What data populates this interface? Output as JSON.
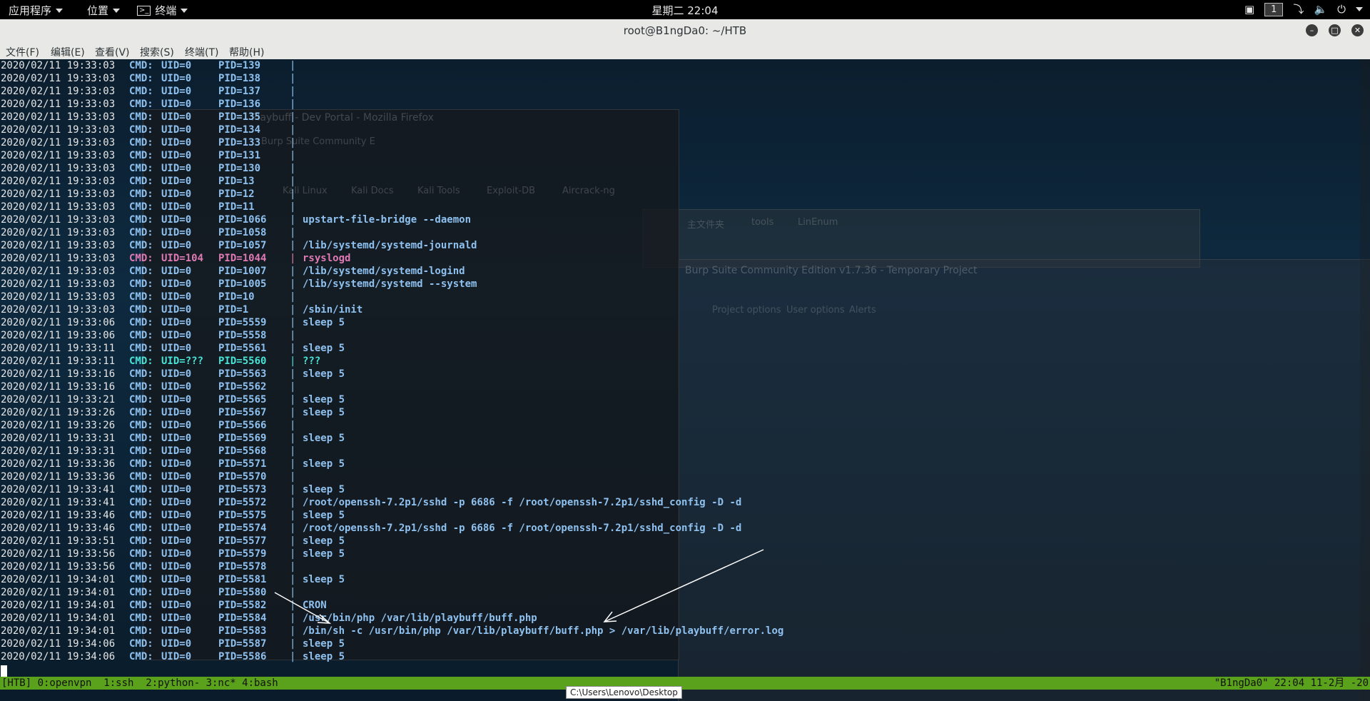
{
  "topbar": {
    "apps": "应用程序",
    "places": "位置",
    "terminal": "终端",
    "clock": "星期二 22:04",
    "workspace": "1"
  },
  "window": {
    "title": "root@B1ngDa0: ~/HTB"
  },
  "menubar": [
    "文件(F)",
    "编辑(E)",
    "查看(V)",
    "搜索(S)",
    "终端(T)",
    "帮助(H)"
  ],
  "background": {
    "firefox_title": "Playbuff - Dev Portal - Mozilla Firefox",
    "firefox_tab": "Burp Suite Community E",
    "bookmarks": [
      "Kali Linux",
      "Kali Docs",
      "Kali Tools",
      "Exploit-DB",
      "Aircrack-ng"
    ],
    "files_items": [
      "主文件夹",
      "tools",
      "LinEnum"
    ],
    "burp_title": "Burp Suite Community Edition v1.7.36 - Temporary Project",
    "burp_tabs": [
      "Project options",
      "User options",
      "Alerts"
    ]
  },
  "lines": [
    {
      "t": "2020/02/11 19:33:03",
      "cmd": "CMD:",
      "uid": "UID=0",
      "pid": "PID=139",
      "c": ""
    },
    {
      "t": "2020/02/11 19:33:03",
      "cmd": "CMD:",
      "uid": "UID=0",
      "pid": "PID=138",
      "c": ""
    },
    {
      "t": "2020/02/11 19:33:03",
      "cmd": "CMD:",
      "uid": "UID=0",
      "pid": "PID=137",
      "c": ""
    },
    {
      "t": "2020/02/11 19:33:03",
      "cmd": "CMD:",
      "uid": "UID=0",
      "pid": "PID=136",
      "c": ""
    },
    {
      "t": "2020/02/11 19:33:03",
      "cmd": "CMD:",
      "uid": "UID=0",
      "pid": "PID=135",
      "c": ""
    },
    {
      "t": "2020/02/11 19:33:03",
      "cmd": "CMD:",
      "uid": "UID=0",
      "pid": "PID=134",
      "c": ""
    },
    {
      "t": "2020/02/11 19:33:03",
      "cmd": "CMD:",
      "uid": "UID=0",
      "pid": "PID=133",
      "c": ""
    },
    {
      "t": "2020/02/11 19:33:03",
      "cmd": "CMD:",
      "uid": "UID=0",
      "pid": "PID=131",
      "c": ""
    },
    {
      "t": "2020/02/11 19:33:03",
      "cmd": "CMD:",
      "uid": "UID=0",
      "pid": "PID=130",
      "c": ""
    },
    {
      "t": "2020/02/11 19:33:03",
      "cmd": "CMD:",
      "uid": "UID=0",
      "pid": "PID=13",
      "c": ""
    },
    {
      "t": "2020/02/11 19:33:03",
      "cmd": "CMD:",
      "uid": "UID=0",
      "pid": "PID=12",
      "c": ""
    },
    {
      "t": "2020/02/11 19:33:03",
      "cmd": "CMD:",
      "uid": "UID=0",
      "pid": "PID=11",
      "c": ""
    },
    {
      "t": "2020/02/11 19:33:03",
      "cmd": "CMD:",
      "uid": "UID=0",
      "pid": "PID=1066",
      "c": "upstart-file-bridge --daemon"
    },
    {
      "t": "2020/02/11 19:33:03",
      "cmd": "CMD:",
      "uid": "UID=0",
      "pid": "PID=1058",
      "c": ""
    },
    {
      "t": "2020/02/11 19:33:03",
      "cmd": "CMD:",
      "uid": "UID=0",
      "pid": "PID=1057",
      "c": "/lib/systemd/systemd-journald"
    },
    {
      "t": "2020/02/11 19:33:03",
      "cmd": "CMD:",
      "uid": "UID=104",
      "pid": "PID=1044",
      "c": "rsyslogd",
      "style": "red"
    },
    {
      "t": "2020/02/11 19:33:03",
      "cmd": "CMD:",
      "uid": "UID=0",
      "pid": "PID=1007",
      "c": "/lib/systemd/systemd-logind"
    },
    {
      "t": "2020/02/11 19:33:03",
      "cmd": "CMD:",
      "uid": "UID=0",
      "pid": "PID=1005",
      "c": "/lib/systemd/systemd --system"
    },
    {
      "t": "2020/02/11 19:33:03",
      "cmd": "CMD:",
      "uid": "UID=0",
      "pid": "PID=10",
      "c": ""
    },
    {
      "t": "2020/02/11 19:33:03",
      "cmd": "CMD:",
      "uid": "UID=0",
      "pid": "PID=1",
      "c": "/sbin/init"
    },
    {
      "t": "2020/02/11 19:33:06",
      "cmd": "CMD:",
      "uid": "UID=0",
      "pid": "PID=5559",
      "c": "sleep 5"
    },
    {
      "t": "2020/02/11 19:33:06",
      "cmd": "CMD:",
      "uid": "UID=0",
      "pid": "PID=5558",
      "c": ""
    },
    {
      "t": "2020/02/11 19:33:11",
      "cmd": "CMD:",
      "uid": "UID=0",
      "pid": "PID=5561",
      "c": "sleep 5"
    },
    {
      "t": "2020/02/11 19:33:11",
      "cmd": "CMD:",
      "uid": "UID=???",
      "pid": "PID=5560",
      "c": "???",
      "style": "cyan"
    },
    {
      "t": "2020/02/11 19:33:16",
      "cmd": "CMD:",
      "uid": "UID=0",
      "pid": "PID=5563",
      "c": "sleep 5"
    },
    {
      "t": "2020/02/11 19:33:16",
      "cmd": "CMD:",
      "uid": "UID=0",
      "pid": "PID=5562",
      "c": ""
    },
    {
      "t": "2020/02/11 19:33:21",
      "cmd": "CMD:",
      "uid": "UID=0",
      "pid": "PID=5565",
      "c": "sleep 5"
    },
    {
      "t": "2020/02/11 19:33:26",
      "cmd": "CMD:",
      "uid": "UID=0",
      "pid": "PID=5567",
      "c": "sleep 5"
    },
    {
      "t": "2020/02/11 19:33:26",
      "cmd": "CMD:",
      "uid": "UID=0",
      "pid": "PID=5566",
      "c": ""
    },
    {
      "t": "2020/02/11 19:33:31",
      "cmd": "CMD:",
      "uid": "UID=0",
      "pid": "PID=5569",
      "c": "sleep 5"
    },
    {
      "t": "2020/02/11 19:33:31",
      "cmd": "CMD:",
      "uid": "UID=0",
      "pid": "PID=5568",
      "c": ""
    },
    {
      "t": "2020/02/11 19:33:36",
      "cmd": "CMD:",
      "uid": "UID=0",
      "pid": "PID=5571",
      "c": "sleep 5"
    },
    {
      "t": "2020/02/11 19:33:36",
      "cmd": "CMD:",
      "uid": "UID=0",
      "pid": "PID=5570",
      "c": ""
    },
    {
      "t": "2020/02/11 19:33:41",
      "cmd": "CMD:",
      "uid": "UID=0",
      "pid": "PID=5573",
      "c": "sleep 5"
    },
    {
      "t": "2020/02/11 19:33:41",
      "cmd": "CMD:",
      "uid": "UID=0",
      "pid": "PID=5572",
      "c": "/root/openssh-7.2p1/sshd -p 6686 -f /root/openssh-7.2p1/sshd_config -D -d"
    },
    {
      "t": "2020/02/11 19:33:46",
      "cmd": "CMD:",
      "uid": "UID=0",
      "pid": "PID=5575",
      "c": "sleep 5"
    },
    {
      "t": "2020/02/11 19:33:46",
      "cmd": "CMD:",
      "uid": "UID=0",
      "pid": "PID=5574",
      "c": "/root/openssh-7.2p1/sshd -p 6686 -f /root/openssh-7.2p1/sshd_config -D -d"
    },
    {
      "t": "2020/02/11 19:33:51",
      "cmd": "CMD:",
      "uid": "UID=0",
      "pid": "PID=5577",
      "c": "sleep 5"
    },
    {
      "t": "2020/02/11 19:33:56",
      "cmd": "CMD:",
      "uid": "UID=0",
      "pid": "PID=5579",
      "c": "sleep 5"
    },
    {
      "t": "2020/02/11 19:33:56",
      "cmd": "CMD:",
      "uid": "UID=0",
      "pid": "PID=5578",
      "c": ""
    },
    {
      "t": "2020/02/11 19:34:01",
      "cmd": "CMD:",
      "uid": "UID=0",
      "pid": "PID=5581",
      "c": "sleep 5"
    },
    {
      "t": "2020/02/11 19:34:01",
      "cmd": "CMD:",
      "uid": "UID=0",
      "pid": "PID=5580",
      "c": ""
    },
    {
      "t": "2020/02/11 19:34:01",
      "cmd": "CMD:",
      "uid": "UID=0",
      "pid": "PID=5582",
      "c": "CRON"
    },
    {
      "t": "2020/02/11 19:34:01",
      "cmd": "CMD:",
      "uid": "UID=0",
      "pid": "PID=5584",
      "c": "/usr/bin/php /var/lib/playbuff/buff.php"
    },
    {
      "t": "2020/02/11 19:34:01",
      "cmd": "CMD:",
      "uid": "UID=0",
      "pid": "PID=5583",
      "c": "/bin/sh -c /usr/bin/php /var/lib/playbuff/buff.php > /var/lib/playbuff/error.log"
    },
    {
      "t": "2020/02/11 19:34:06",
      "cmd": "CMD:",
      "uid": "UID=0",
      "pid": "PID=5587",
      "c": "sleep 5"
    },
    {
      "t": "2020/02/11 19:34:06",
      "cmd": "CMD:",
      "uid": "UID=0",
      "pid": "PID=5586",
      "c": "sleep 5"
    }
  ],
  "tmux": {
    "left": "[HTB] 0:openvpn  1:ssh  2:python- 3:nc* 4:bash",
    "right": "\"B1ngDa0\" 22:04 11-2月 -20"
  },
  "tooltip": "C:\\Users\\Lenovo\\Desktop",
  "colors": {
    "tmux_bar": "#5aa11c",
    "text_blue": "#8ec1ef",
    "text_red": "#e07ab5",
    "text_cyan": "#48e3d6"
  }
}
